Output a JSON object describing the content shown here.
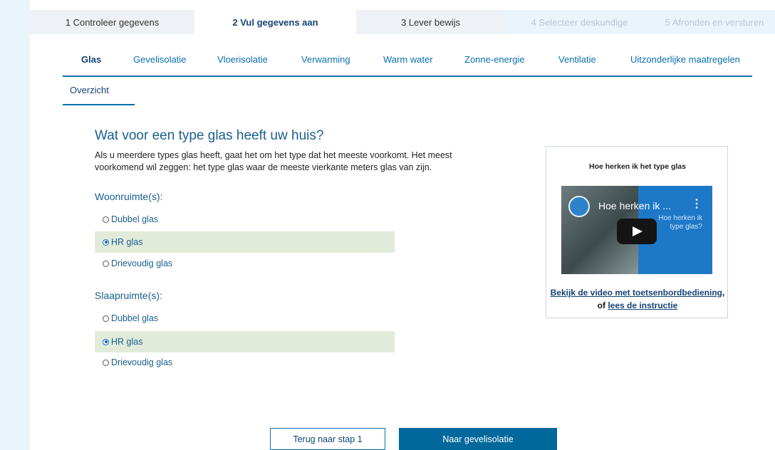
{
  "steps": [
    {
      "label": "1 Controleer gegevens",
      "state": "done"
    },
    {
      "label": "2 Vul gegevens aan",
      "state": "active"
    },
    {
      "label": "3 Lever bewijs",
      "state": "todo"
    },
    {
      "label": "4 Selecteer deskundige",
      "state": "disabled"
    },
    {
      "label": "5 Afronden en versturen",
      "state": "disabled"
    }
  ],
  "tabs": [
    {
      "label": "Glas",
      "active": true
    },
    {
      "label": "Gevelisolatie"
    },
    {
      "label": "Vloerisolatie"
    },
    {
      "label": "Verwarming"
    },
    {
      "label": "Warm water"
    },
    {
      "label": "Zonne-energie"
    },
    {
      "label": "Ventilatie"
    },
    {
      "label": "Uitzonderlijke maatregelen"
    }
  ],
  "subtab": {
    "label": "Overzicht"
  },
  "question": {
    "title": "Wat voor een type glas heeft uw huis?",
    "intro": "Als u meerdere types glas heeft, gaat het om het type dat het meeste voorkomt. Het meest voorkomend wil zeggen: het type glas waar de meeste vierkante meters glas van zijn."
  },
  "groups": [
    {
      "label": "Woonruimte(s):",
      "options": [
        {
          "label": "Dubbel glas",
          "selected": false
        },
        {
          "label": "HR glas",
          "selected": true
        },
        {
          "label": "Drievoudig glas",
          "selected": false
        }
      ]
    },
    {
      "label": "Slaapruimte(s):",
      "options": [
        {
          "label": "Dubbel glas",
          "selected": false
        },
        {
          "label": "HR glas",
          "selected": true
        },
        {
          "label": "Drievoudig glas",
          "selected": false
        }
      ]
    }
  ],
  "video": {
    "box_title": "Hoe herken ik het type glas",
    "player_title": "Hoe herken ik ...",
    "overlay_text": "Hoe herken ik type glas?",
    "link_keyboard": "Bekijk de video met toetsenbordbediening",
    "or_text": "of",
    "link_instruction": "lees de instructie",
    "comma": ","
  },
  "buttons": {
    "back": "Terug naar stap 1",
    "next": "Naar gevelisolatie"
  }
}
